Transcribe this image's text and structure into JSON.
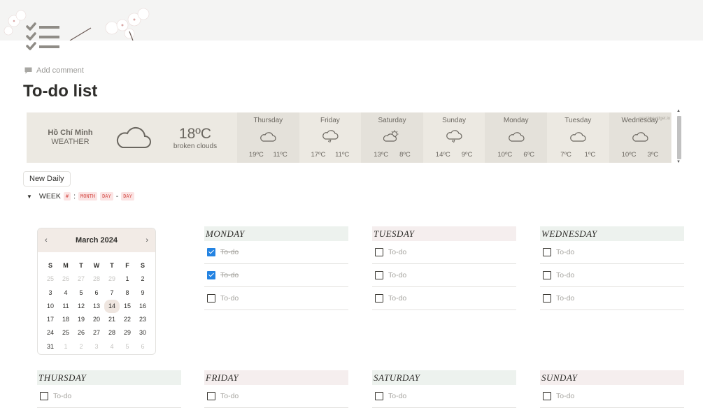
{
  "page": {
    "title": "To-do list",
    "add_comment": "Add comment"
  },
  "weather": {
    "city": "Hồ Chí Minh",
    "label": "WEATHER",
    "current_temp": "18ºC",
    "current_desc": "broken clouds",
    "credit": "weatherwidget.io",
    "forecast": [
      {
        "day": "Thursday",
        "icon": "cloud-icon",
        "hi": "19ºC",
        "lo": "11ºC"
      },
      {
        "day": "Friday",
        "icon": "rain-cloud-icon",
        "hi": "17ºC",
        "lo": "11ºC"
      },
      {
        "day": "Saturday",
        "icon": "partly-sunny-icon",
        "hi": "13ºC",
        "lo": "8ºC"
      },
      {
        "day": "Sunday",
        "icon": "rain-cloud-icon",
        "hi": "14ºC",
        "lo": "9ºC"
      },
      {
        "day": "Monday",
        "icon": "cloud-icon",
        "hi": "10ºC",
        "lo": "6ºC"
      },
      {
        "day": "Tuesday",
        "icon": "cloud-icon",
        "hi": "7ºC",
        "lo": "1ºC"
      },
      {
        "day": "Wednesday",
        "icon": "cloud-icon",
        "hi": "10ºC",
        "lo": "3ºC"
      }
    ]
  },
  "controls": {
    "new_daily": "New Daily",
    "week_label": "WEEK",
    "tag_hash": "#",
    "colon": ":",
    "tag_month": "MONTH",
    "tag_day1": "DAY",
    "dash": "-",
    "tag_day2": "DAY"
  },
  "calendar": {
    "month": "March 2024",
    "prev": "‹",
    "next": "›",
    "weekdays": [
      "S",
      "M",
      "T",
      "W",
      "T",
      "F",
      "S"
    ],
    "weeks": [
      [
        "25",
        "26",
        "27",
        "28",
        "29",
        "1",
        "2"
      ],
      [
        "3",
        "4",
        "5",
        "6",
        "7",
        "8",
        "9"
      ],
      [
        "10",
        "11",
        "12",
        "13",
        "14",
        "15",
        "16"
      ],
      [
        "17",
        "18",
        "19",
        "20",
        "21",
        "22",
        "23"
      ],
      [
        "24",
        "25",
        "26",
        "27",
        "28",
        "29",
        "30"
      ],
      [
        "31",
        "1",
        "2",
        "3",
        "4",
        "5",
        "6"
      ]
    ],
    "today": "14"
  },
  "days": [
    {
      "name": "MONDAY",
      "tint": "green",
      "todos": [
        {
          "text": "To-do",
          "checked": true
        },
        {
          "text": "To-do",
          "checked": true
        },
        {
          "text": "To-do",
          "checked": false
        }
      ]
    },
    {
      "name": "TUESDAY",
      "tint": "pink",
      "todos": [
        {
          "text": "To-do",
          "checked": false
        },
        {
          "text": "To-do",
          "checked": false
        },
        {
          "text": "To-do",
          "checked": false
        }
      ]
    },
    {
      "name": "WEDNESDAY",
      "tint": "green",
      "todos": [
        {
          "text": "To-do",
          "checked": false
        },
        {
          "text": "To-do",
          "checked": false
        },
        {
          "text": "To-do",
          "checked": false
        }
      ]
    },
    {
      "name": "THURSDAY",
      "tint": "green",
      "todos": [
        {
          "text": "To-do",
          "checked": false
        }
      ]
    },
    {
      "name": "FRIDAY",
      "tint": "pink",
      "todos": [
        {
          "text": "To-do",
          "checked": false
        }
      ]
    },
    {
      "name": "SATURDAY",
      "tint": "green",
      "todos": [
        {
          "text": "To-do",
          "checked": false
        }
      ]
    },
    {
      "name": "SUNDAY",
      "tint": "pink",
      "todos": [
        {
          "text": "To-do",
          "checked": false
        }
      ]
    }
  ],
  "colors": {
    "checkbox_checked": "#2383e2",
    "weather_bg": "#ece9e2",
    "tag_text": "#d44c47"
  }
}
